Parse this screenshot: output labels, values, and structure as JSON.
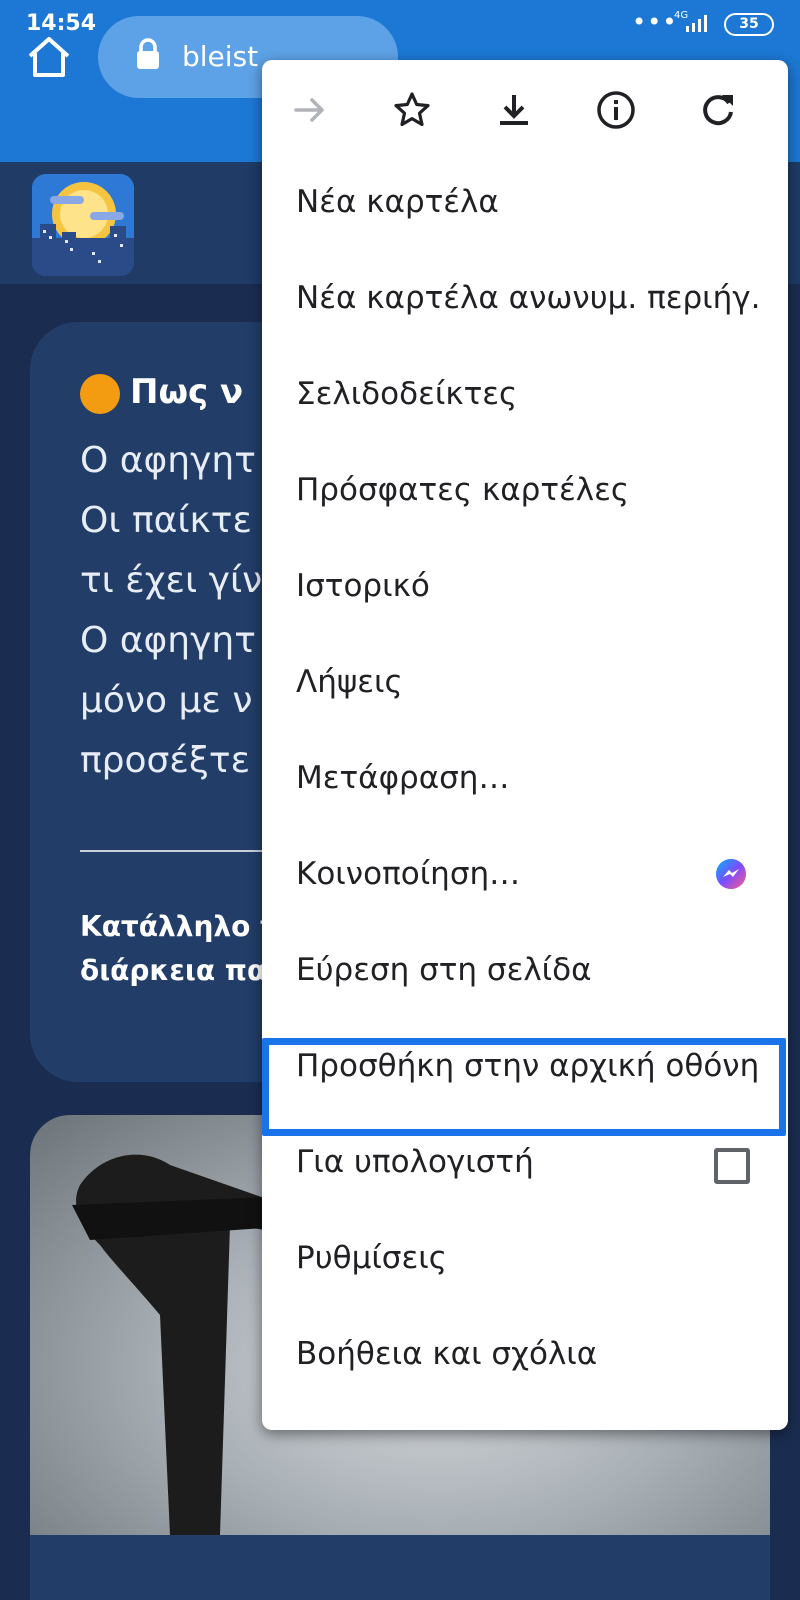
{
  "status_bar": {
    "time": "14:54",
    "dots": "•••",
    "network": "4G",
    "battery": "35"
  },
  "toolbar": {
    "url_partial": "bleist"
  },
  "card": {
    "title_partial": "Πως ν",
    "lines": [
      "Ο αφηγητ",
      "Οι παίκτε",
      "τι έχει γίν",
      "Ο αφηγητ",
      "μόνο με ν",
      "προσέξτε"
    ],
    "bold_lines": [
      "Κατάλληλο γ",
      "διάρκεια πα"
    ]
  },
  "menu": {
    "items": [
      {
        "label": "Νέα καρτέλα"
      },
      {
        "label": "Νέα καρτέλα ανωνυμ. περιήγ."
      },
      {
        "label": "Σελιδοδείκτες"
      },
      {
        "label": "Πρόσφατες καρτέλες"
      },
      {
        "label": "Ιστορικό"
      },
      {
        "label": "Λήψεις"
      },
      {
        "label": "Μετάφραση…"
      },
      {
        "label": "Κοινοποίηση…"
      },
      {
        "label": "Εύρεση στη σελίδα"
      },
      {
        "label": "Προσθήκη στην αρχική οθόνη"
      },
      {
        "label": "Για υπολογιστή"
      },
      {
        "label": "Ρυθμίσεις"
      },
      {
        "label": "Βοήθεια και σχόλια"
      }
    ],
    "icons": [
      "forward-icon",
      "star-icon",
      "download-icon",
      "info-icon",
      "refresh-icon"
    ],
    "desktop_site_checked": false
  },
  "colors": {
    "toolbar": "#1c78d4",
    "page_bg": "#1a2d50",
    "highlight": "#1a73e8"
  }
}
